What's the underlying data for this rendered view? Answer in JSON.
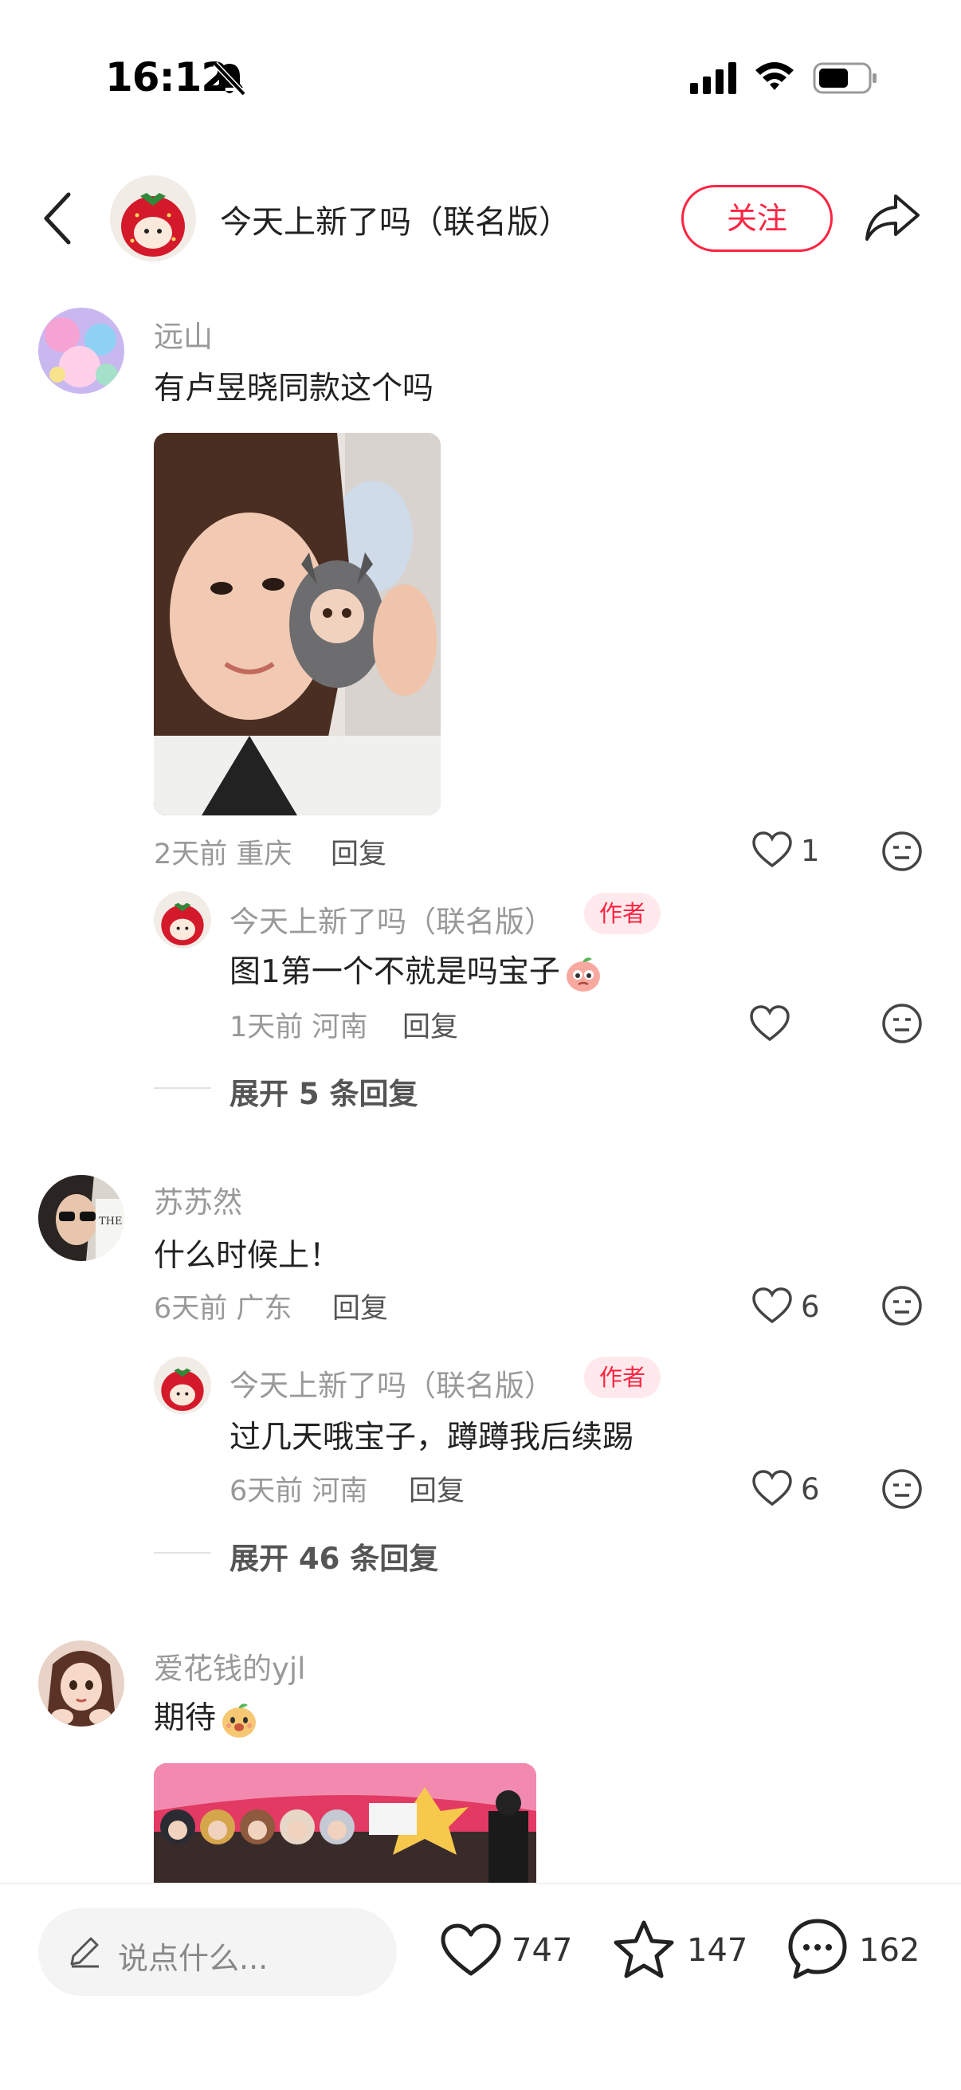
{
  "status_bar": {
    "time": "16:12"
  },
  "header": {
    "title": "今天上新了吗（联名版）",
    "follow_label": "关注"
  },
  "comments": [
    {
      "username": "远山",
      "text": "有卢昱晓同款这个吗",
      "time_location": "2天前 重庆",
      "reply_label": "回复",
      "likes": "1",
      "reply": {
        "username": "今天上新了吗（联名版）",
        "badge": "作者",
        "text": "图1第一个不就是吗宝子",
        "time_location": "1天前 河南",
        "reply_label": "回复"
      },
      "expand_label": "展开 5 条回复"
    },
    {
      "username": "苏苏然",
      "text": "什么时候上！",
      "time_location": "6天前 广东",
      "reply_label": "回复",
      "likes": "6",
      "reply": {
        "username": "今天上新了吗（联名版）",
        "badge": "作者",
        "text": "过几天哦宝子，蹲蹲我后续踢",
        "time_location": "6天前 河南",
        "reply_label": "回复",
        "likes": "6"
      },
      "expand_label": "展开 46 条回复"
    },
    {
      "username": "爱花钱的yjl",
      "text": "期待"
    }
  ],
  "bottom_bar": {
    "placeholder": "说点什么...",
    "likes": "747",
    "stars": "147",
    "comments": "162"
  },
  "colors": {
    "accent": "#ff2442",
    "muted": "#999999"
  }
}
